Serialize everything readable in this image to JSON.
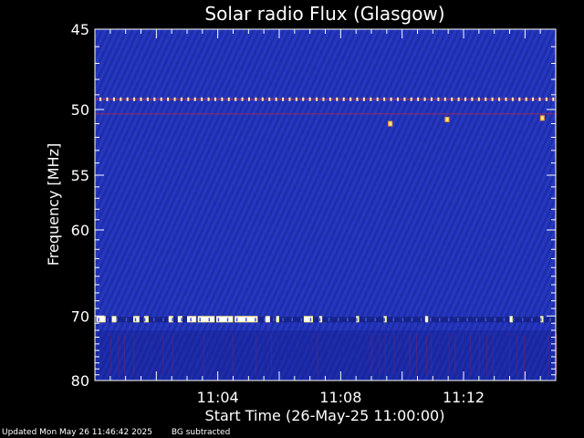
{
  "chart_data": {
    "type": "heatmap",
    "title": "Solar radio Flux (Glasgow)",
    "xlabel": "Start Time (26-May-25 11:00:00)",
    "ylabel": "Frequency [MHz]",
    "x_unit": "minutes after 11:00:00",
    "xlim": [
      0.0,
      15.0
    ],
    "x_ticks": [
      {
        "value": 4,
        "label": "11:04"
      },
      {
        "value": 8,
        "label": "11:08"
      },
      {
        "value": 12,
        "label": "11:12"
      }
    ],
    "ylim": [
      45,
      80
    ],
    "y_ticks": [
      {
        "value": 45,
        "label": "45"
      },
      {
        "value": 50,
        "label": "50"
      },
      {
        "value": 55,
        "label": "55"
      },
      {
        "value": 60,
        "label": "60"
      },
      {
        "value": 70,
        "label": "70"
      },
      {
        "value": 80,
        "label": "80"
      }
    ],
    "background_color": "#2233b8",
    "burst_colors": [
      "#ffffff",
      "#ffee88",
      "#ff9922",
      "#cc2222"
    ],
    "interference_bands": [
      {
        "freq": 49.3,
        "kind": "periodic"
      },
      {
        "freq": 50.3,
        "kind": "sparse"
      },
      {
        "freq": 70.5,
        "kind": "bursts"
      }
    ],
    "bursts_70MHz": [
      [
        0.05,
        0.35
      ],
      [
        0.55,
        0.7
      ],
      [
        1.25,
        1.45
      ],
      [
        1.6,
        1.75
      ],
      [
        2.4,
        2.55
      ],
      [
        2.7,
        2.85
      ],
      [
        3.0,
        3.3
      ],
      [
        3.35,
        3.9
      ],
      [
        3.95,
        4.5
      ],
      [
        4.55,
        5.3
      ],
      [
        5.55,
        5.7
      ],
      [
        5.9,
        6.0
      ],
      [
        6.8,
        7.1
      ],
      [
        7.3,
        7.4
      ],
      [
        8.5,
        8.6
      ],
      [
        9.4,
        9.5
      ],
      [
        10.75,
        10.85
      ],
      [
        13.5,
        13.6
      ],
      [
        14.5,
        14.6
      ]
    ],
    "bright_spots": [
      {
        "t": 9.6,
        "freq": 51.0
      },
      {
        "t": 11.45,
        "freq": 50.7
      },
      {
        "t": 14.55,
        "freq": 50.6
      }
    ]
  },
  "footer": {
    "updated": "Updated Mon May 26 11:46:42 2025",
    "note": "BG subtracted"
  }
}
